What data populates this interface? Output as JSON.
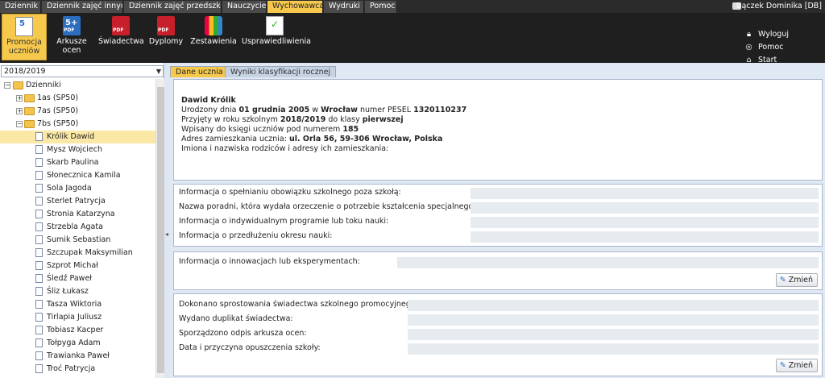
{
  "topmenu": {
    "tabs": [
      "Dziennik",
      "Dziennik zajęć innych",
      "Dziennik zajęć przedszkola",
      "Nauczyciel",
      "Wychowawca",
      "Wydruki",
      "Pomoc"
    ],
    "active": "Wychowawca",
    "user": "Bączek Dominika [DB]"
  },
  "ribbon": {
    "buttons": [
      {
        "label1": "Promocja",
        "label2": "uczniów",
        "icon": "promotion-icon"
      },
      {
        "label1": "Arkusze",
        "label2": "ocen",
        "icon": "grade-sheets-pdf-icon"
      },
      {
        "label1": "Świadectwa",
        "label2": "",
        "icon": "certificates-pdf-icon"
      },
      {
        "label1": "Dyplomy",
        "label2": "",
        "icon": "diplomas-pdf-icon"
      },
      {
        "label1": "Zestawienia",
        "label2": "",
        "icon": "reports-icon"
      },
      {
        "label1": "Usprawiedliwienia",
        "label2": "",
        "icon": "excuses-icon"
      }
    ],
    "actions": {
      "logout": "Wyloguj",
      "help": "Pomoc",
      "start": "Start"
    }
  },
  "left": {
    "year": "2018/2019",
    "root": "Dzienniki",
    "classes": [
      "1as (SP50)",
      "7as (SP50)",
      "7bs (SP50)"
    ],
    "students": [
      "Królik Dawid",
      "Mysz Wojciech",
      "Skarb Paulina",
      "Słonecznica Kamila",
      "Sola Jagoda",
      "Sterlet Patrycja",
      "Stronia Katarzyna",
      "Strzebla Agata",
      "Sumik Sebastian",
      "Szczupak Maksymilian",
      "Szprot Michał",
      "Śledź Paweł",
      "Śliz Łukasz",
      "Tasza Wiktoria",
      "Tirlapia Juliusz",
      "Tobiasz Kacper",
      "Tołpyga Adam",
      "Trawianka Paweł",
      "Troć Patrycja"
    ]
  },
  "content": {
    "tabs": {
      "active": "Dane ucznia",
      "inactive": "Wyniki klasyfikacji rocznej"
    },
    "student": {
      "name": "Dawid Królik",
      "born_prefix": "Urodzony dnia ",
      "born_date": "01 grudnia 2005",
      "born_mid": " w ",
      "born_city": "Wrocław",
      "pesel_label": " numer PESEL ",
      "pesel": "1320110237",
      "admitted_prefix": "Przyjęty w roku szkolnym ",
      "admitted_year": "2018/2019",
      "admitted_mid": " do klasy ",
      "admitted_class": "pierwszej",
      "book_prefix": "Wpisany do księgi uczniów pod numerem ",
      "book_number": "185",
      "address_prefix": "Adres zamieszkania ucznia: ",
      "address": "ul. Orla 56, 59-306 Wrocław, Polska",
      "parents": "Imiona i nazwiska rodziców i adresy ich zamieszkania:"
    },
    "panel2": [
      "Informacja o spełnianiu obowiązku szkolnego poza szkołą:",
      "Nazwa poradni, która wydała orzeczenie o potrzebie kształcenia specjalnego:",
      "Informacja o indywidualnym programie lub toku nauki:",
      "Informacja o przedłużeniu okresu nauki:"
    ],
    "panel3": {
      "label": "Informacja o innowacjach lub eksperymentach:",
      "button": "Zmień"
    },
    "panel4": {
      "rows": [
        "Dokonano sprostowania świadectwa szkolnego promocyjnego:",
        "Wydano duplikat świadectwa:",
        "Sporządzono odpis arkusza ocen:",
        "Data i przyczyna opuszczenia szkoły:"
      ],
      "button": "Zmień"
    }
  }
}
